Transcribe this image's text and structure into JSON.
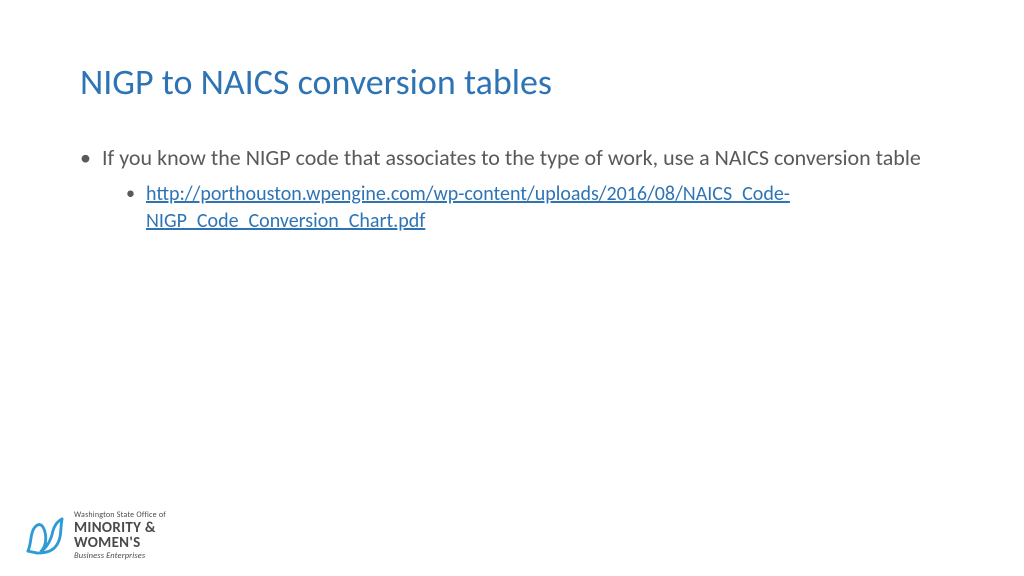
{
  "title": "NIGP to NAICS conversion tables",
  "bullet": {
    "text": "If you know the NIGP code that associates to the type of work, use a NAICS conversion table",
    "sub_link": "http://porthouston.wpengine.com/wp-content/uploads/2016/08/NAICS_Code-NIGP_Code_Conversion_Chart.pdf"
  },
  "logo": {
    "line1": "Washington State Office of",
    "line2": "MINORITY &",
    "line3": "WOMEN'S",
    "line4": "Business Enterprises"
  }
}
